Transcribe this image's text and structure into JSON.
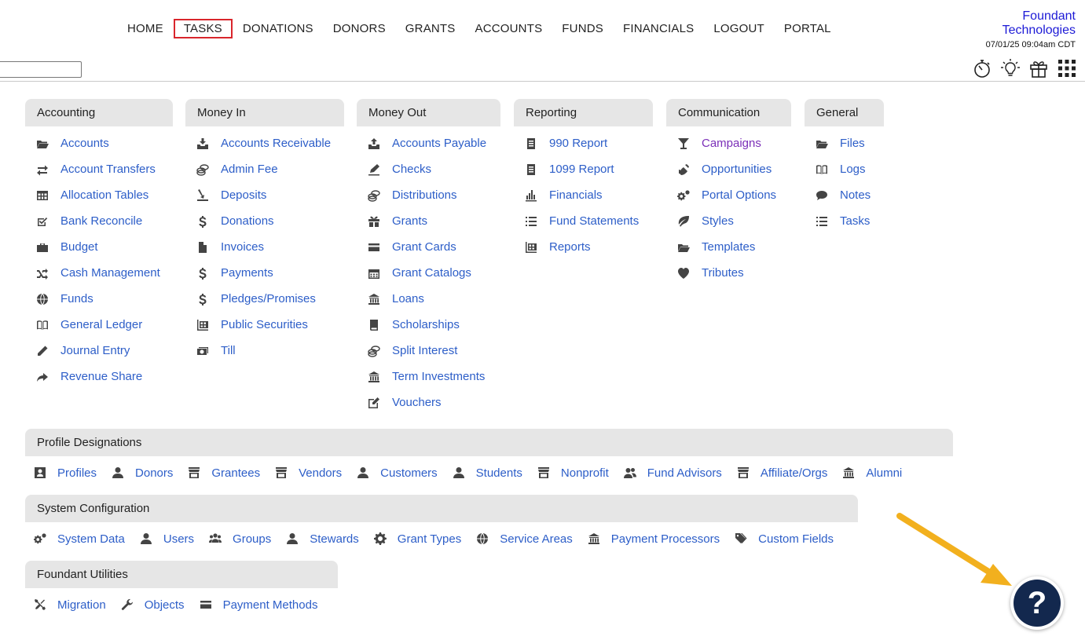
{
  "nav": {
    "items": [
      "HOME",
      "TASKS",
      "DONATIONS",
      "DONORS",
      "GRANTS",
      "ACCOUNTS",
      "FUNDS",
      "FINANCIALS",
      "LOGOUT",
      "PORTAL"
    ],
    "active": "TASKS"
  },
  "brand": {
    "line1": "Foundant",
    "line2": "Technologies",
    "timestamp": "07/01/25 09:04am CDT"
  },
  "top_icons": [
    "stopwatch-icon",
    "lightbulb-icon",
    "gift-icon",
    "apps-grid-icon"
  ],
  "columns": [
    {
      "title": "Accounting",
      "items": [
        {
          "label": "Accounts",
          "icon": "folder-open-icon"
        },
        {
          "label": "Account Transfers",
          "icon": "transfer-icon"
        },
        {
          "label": "Allocation Tables",
          "icon": "table-icon"
        },
        {
          "label": "Bank Reconcile",
          "icon": "checkbox-icon"
        },
        {
          "label": "Budget",
          "icon": "briefcase-icon"
        },
        {
          "label": "Cash Management",
          "icon": "shuffle-icon"
        },
        {
          "label": "Funds",
          "icon": "globe-icon"
        },
        {
          "label": "General Ledger",
          "icon": "book-icon"
        },
        {
          "label": "Journal Entry",
          "icon": "pencil-icon"
        },
        {
          "label": "Revenue Share",
          "icon": "share-arrow-icon"
        }
      ]
    },
    {
      "title": "Money In",
      "items": [
        {
          "label": "Accounts Receivable",
          "icon": "inbox-download-icon"
        },
        {
          "label": "Admin Fee",
          "icon": "coins-icon"
        },
        {
          "label": "Deposits",
          "icon": "deposit-icon"
        },
        {
          "label": "Donations",
          "icon": "dollar-icon"
        },
        {
          "label": "Invoices",
          "icon": "file-icon"
        },
        {
          "label": "Payments",
          "icon": "dollar-icon"
        },
        {
          "label": "Pledges/Promises",
          "icon": "dollar-icon"
        },
        {
          "label": "Public Securities",
          "icon": "chart-grid-icon"
        },
        {
          "label": "Till",
          "icon": "cash-icon"
        }
      ]
    },
    {
      "title": "Money Out",
      "items": [
        {
          "label": "Accounts Payable",
          "icon": "inbox-upload-icon"
        },
        {
          "label": "Checks",
          "icon": "check-sign-icon"
        },
        {
          "label": "Distributions",
          "icon": "coins-icon"
        },
        {
          "label": "Grants",
          "icon": "gift-icon"
        },
        {
          "label": "Grant Cards",
          "icon": "credit-card-icon"
        },
        {
          "label": "Grant Catalogs",
          "icon": "calendar-icon"
        },
        {
          "label": "Loans",
          "icon": "bank-icon"
        },
        {
          "label": "Scholarships",
          "icon": "book-closed-icon"
        },
        {
          "label": "Split Interest",
          "icon": "coins-icon"
        },
        {
          "label": "Term Investments",
          "icon": "bank-icon"
        },
        {
          "label": "Vouchers",
          "icon": "edit-icon"
        }
      ]
    },
    {
      "title": "Reporting",
      "items": [
        {
          "label": "990 Report",
          "icon": "report-icon"
        },
        {
          "label": "1099 Report",
          "icon": "report-icon"
        },
        {
          "label": "Financials",
          "icon": "bar-chart-icon"
        },
        {
          "label": "Fund Statements",
          "icon": "list-icon"
        },
        {
          "label": "Reports",
          "icon": "chart-grid-icon"
        }
      ]
    },
    {
      "title": "Communication",
      "items": [
        {
          "label": "Campaigns",
          "icon": "glass-icon",
          "visited": true
        },
        {
          "label": "Opportunities",
          "icon": "satellite-dish-icon"
        },
        {
          "label": "Portal Options",
          "icon": "cogs-icon"
        },
        {
          "label": "Styles",
          "icon": "leaf-icon"
        },
        {
          "label": "Templates",
          "icon": "folder-open-icon"
        },
        {
          "label": "Tributes",
          "icon": "heart-icon"
        }
      ]
    },
    {
      "title": "General",
      "items": [
        {
          "label": "Files",
          "icon": "folder-open-icon"
        },
        {
          "label": "Logs",
          "icon": "book-icon"
        },
        {
          "label": "Notes",
          "icon": "comment-icon"
        },
        {
          "label": "Tasks",
          "icon": "list-icon"
        }
      ]
    }
  ],
  "profile": {
    "title": "Profile Designations",
    "items": [
      {
        "label": "Profiles",
        "icon": "profile-card-icon"
      },
      {
        "label": "Donors",
        "icon": "user-icon"
      },
      {
        "label": "Grantees",
        "icon": "store-icon"
      },
      {
        "label": "Vendors",
        "icon": "store-icon"
      },
      {
        "label": "Customers",
        "icon": "user-icon"
      },
      {
        "label": "Students",
        "icon": "user-icon"
      },
      {
        "label": "Nonprofit",
        "icon": "store-icon"
      },
      {
        "label": "Fund Advisors",
        "icon": "users-icon"
      },
      {
        "label": "Affiliate/Orgs",
        "icon": "store-icon"
      },
      {
        "label": "Alumni",
        "icon": "bank-icon"
      }
    ]
  },
  "system": {
    "title": "System Configuration",
    "items": [
      {
        "label": "System Data",
        "icon": "cogs-icon"
      },
      {
        "label": "Users",
        "icon": "user-icon"
      },
      {
        "label": "Groups",
        "icon": "group-icon"
      },
      {
        "label": "Stewards",
        "icon": "user-icon"
      },
      {
        "label": "Grant Types",
        "icon": "gear-icon"
      },
      {
        "label": "Service Areas",
        "icon": "globe-icon"
      },
      {
        "label": "Payment Processors",
        "icon": "bank-icon"
      },
      {
        "label": "Custom Fields",
        "icon": "tags-icon"
      }
    ]
  },
  "utilities": {
    "title": "Foundant Utilities",
    "items": [
      {
        "label": "Migration",
        "icon": "tools-icon"
      },
      {
        "label": "Objects",
        "icon": "wrench-icon"
      },
      {
        "label": "Payment Methods",
        "icon": "credit-card-icon"
      }
    ]
  },
  "help": {
    "label": "?"
  },
  "colors": {
    "link": "#2d5ec8",
    "visited": "#7b2fb8",
    "active_border": "#d9262c",
    "brand": "#1d1ad6",
    "help_bg": "#13284e",
    "arrow": "#f2b01e"
  }
}
